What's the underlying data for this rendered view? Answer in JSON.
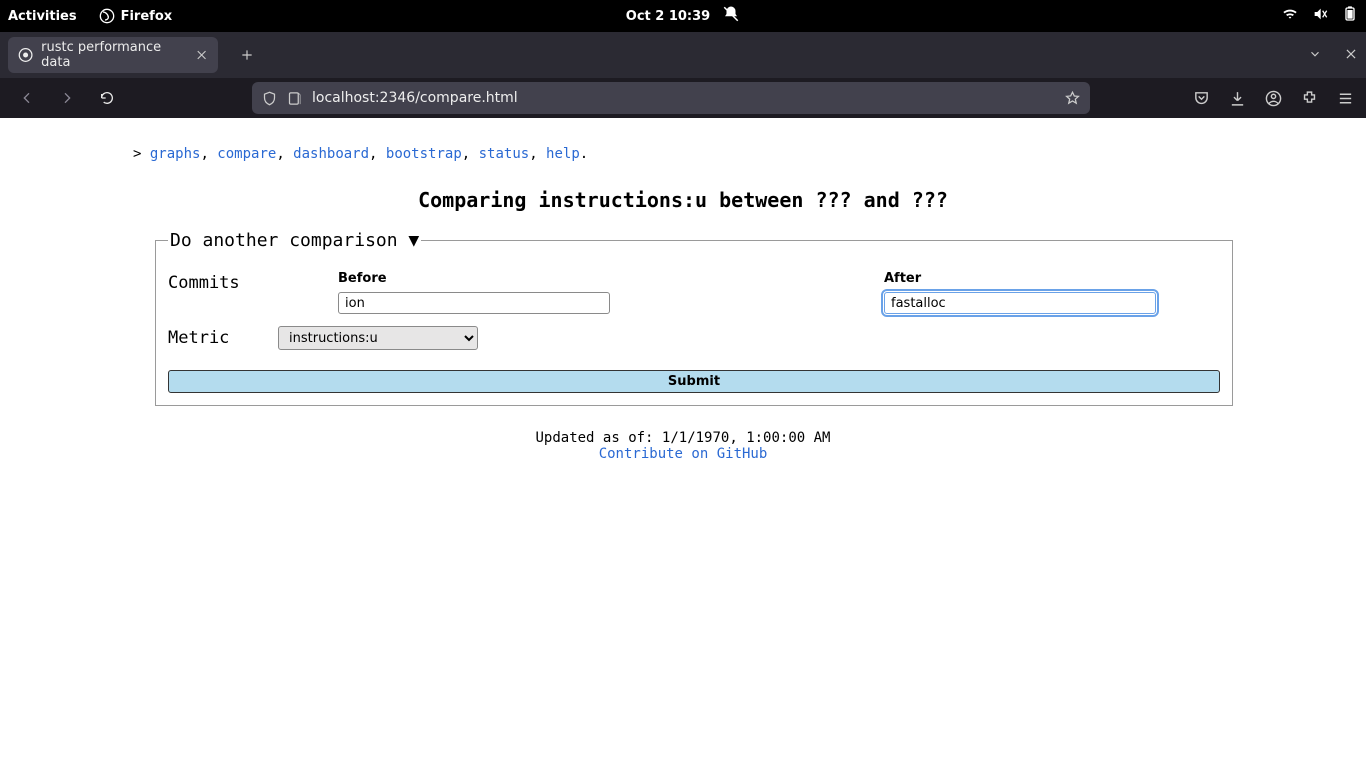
{
  "os_bar": {
    "activities": "Activities",
    "app_name": "Firefox",
    "datetime": "Oct 2  10:39"
  },
  "browser": {
    "tab_title": "rustc performance data",
    "url": "localhost:2346/compare.html"
  },
  "nav": {
    "prefix": "> ",
    "links": [
      "graphs",
      "compare",
      "dashboard",
      "bootstrap",
      "status",
      "help"
    ]
  },
  "page": {
    "title": "Comparing instructions:u between ??? and ???",
    "fieldset_legend": "Do another comparison ▼",
    "commits_label": "Commits",
    "before_label": "Before",
    "after_label": "After",
    "before_value": "ion",
    "after_value": "fastalloc",
    "metric_label": "Metric",
    "metric_selected": "instructions:u",
    "submit_label": "Submit",
    "updated": "Updated as of: 1/1/1970, 1:00:00 AM",
    "contribute": "Contribute on GitHub"
  }
}
